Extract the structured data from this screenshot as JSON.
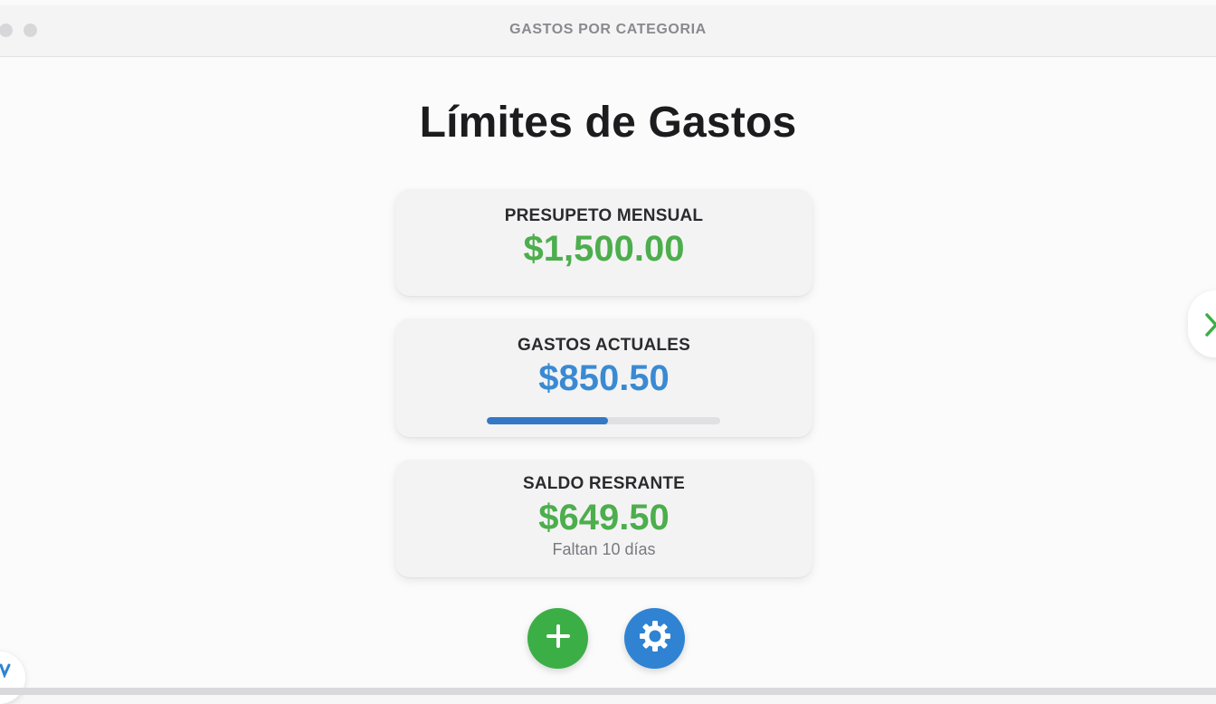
{
  "window": {
    "title": "GASTOS POR CATEGORIA"
  },
  "page": {
    "title": "Límites de Gastos"
  },
  "cards": {
    "budget": {
      "label": "PRESUPETO MENSUAL",
      "amount": "$1,500.00",
      "color": "#4cae4c"
    },
    "current": {
      "label": "GASTOS ACTUALES",
      "amount": "$850.50",
      "color": "#3a8ad3",
      "progress_fraction": 0.52
    },
    "remaining": {
      "label": "SALDO RESRANTE",
      "amount": "$649.50",
      "subtext": "Faltan 10 días",
      "color": "#4cae4c"
    }
  },
  "actions": {
    "add_icon": "plus-icon",
    "add_color": "#3cae46",
    "settings_icon": "gear-icon",
    "settings_color": "#2f83d2"
  },
  "navigation": {
    "next_icon": "chevron-right-icon"
  }
}
